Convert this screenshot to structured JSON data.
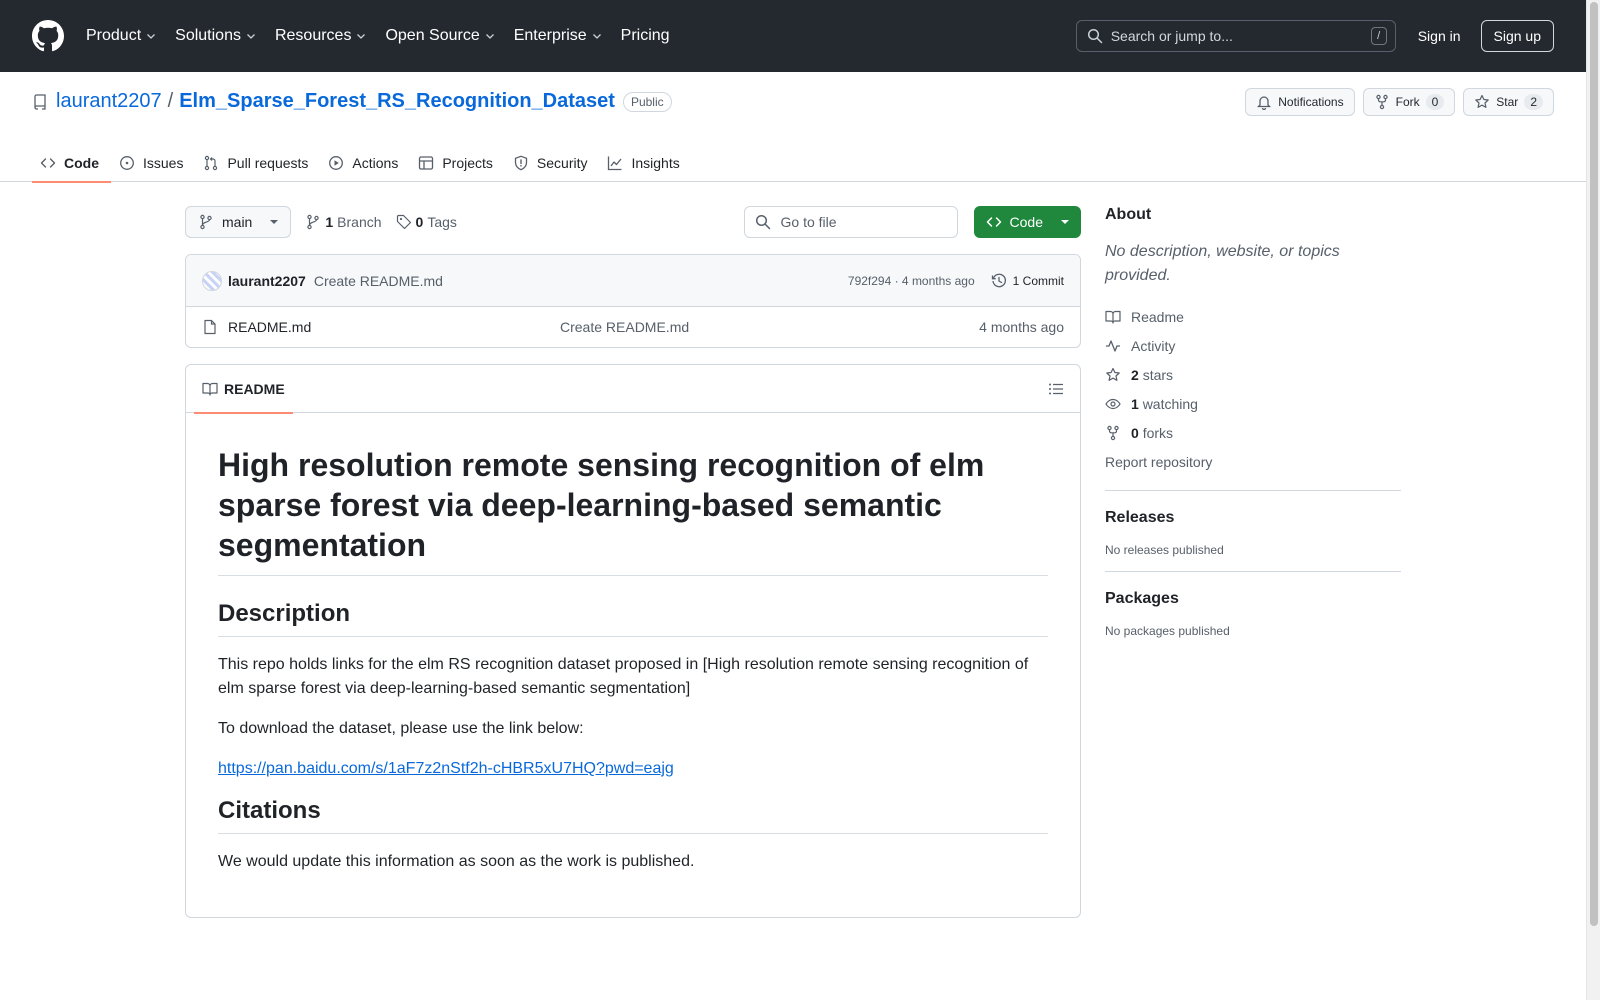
{
  "header": {
    "nav": [
      "Product",
      "Solutions",
      "Resources",
      "Open Source",
      "Enterprise",
      "Pricing"
    ],
    "search_placeholder": "Search or jump to...",
    "search_shortcut": "/",
    "sign_in": "Sign in",
    "sign_up": "Sign up"
  },
  "repo": {
    "owner": "laurant2207",
    "separator": "/",
    "name": "Elm_Sparse_Forest_RS_Recognition_Dataset",
    "visibility": "Public",
    "notifications_label": "Notifications",
    "fork_label": "Fork",
    "fork_count": "0",
    "star_label": "Star",
    "star_count": "2",
    "tabs": [
      "Code",
      "Issues",
      "Pull requests",
      "Actions",
      "Projects",
      "Security",
      "Insights"
    ]
  },
  "toolbar": {
    "branch": "main",
    "branch_count": "1",
    "branch_label": "Branch",
    "tag_count": "0",
    "tag_label": "Tags",
    "goto_placeholder": "Go to file",
    "code_label": "Code"
  },
  "commit": {
    "author": "laurant2207",
    "message": "Create README.md",
    "hash_time": "792f294 · 4 months ago",
    "history": "1 Commit"
  },
  "files": [
    {
      "name": "README.md",
      "message": "Create README.md",
      "time": "4 months ago"
    }
  ],
  "readme": {
    "tab_label": "README",
    "h1": "High resolution remote sensing recognition of elm sparse forest via deep-learning-based semantic segmentation",
    "h2_description": "Description",
    "p1": "This repo holds links for the elm RS recognition dataset proposed in [High resolution remote sensing recognition of elm sparse forest via deep-learning-based semantic segmentation]",
    "p2": "To download the dataset, please use the link below:",
    "link": "https://pan.baidu.com/s/1aF7z2nStf2h-cHBR5xU7HQ?pwd=eajg",
    "h2_citations": "Citations",
    "p3": "We would update this information as soon as the work is published."
  },
  "about": {
    "title": "About",
    "description": "No description, website, or topics provided.",
    "readme": "Readme",
    "activity": "Activity",
    "stars_count": "2",
    "stars_label": "stars",
    "watching_count": "1",
    "watching_label": "watching",
    "forks_count": "0",
    "forks_label": "forks",
    "report": "Report repository"
  },
  "releases": {
    "title": "Releases",
    "text": "No releases published"
  },
  "packages": {
    "title": "Packages",
    "text": "No packages published"
  },
  "colors": {
    "header_bg": "#24292f",
    "link": "#0969da",
    "code_button": "#1f883d",
    "active_tab_underline": "#fd8c73"
  }
}
